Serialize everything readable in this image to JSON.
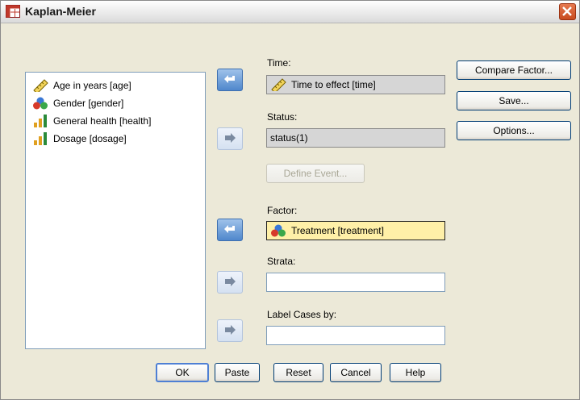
{
  "window": {
    "title": "Kaplan-Meier"
  },
  "variables": [
    {
      "label": "Age in years [age]",
      "icon": "scale-ruler-icon"
    },
    {
      "label": "Gender [gender]",
      "icon": "nominal-circles-icon"
    },
    {
      "label": "General health [health]",
      "icon": "ordinal-bars-icon"
    },
    {
      "label": "Dosage [dosage]",
      "icon": "ordinal-bars-icon"
    }
  ],
  "time": {
    "label": "Time:",
    "value": "Time to effect [time]"
  },
  "status": {
    "label": "Status:",
    "value": "status(1)",
    "define_event": "Define Event..."
  },
  "factor": {
    "label": "Factor:",
    "value": "Treatment [treatment]"
  },
  "strata": {
    "label": "Strata:",
    "value": ""
  },
  "label_cases": {
    "label": "Label Cases by:",
    "value": ""
  },
  "side_buttons": {
    "compare": "Compare Factor...",
    "save": "Save...",
    "options": "Options..."
  },
  "footer": {
    "ok": "OK",
    "paste": "Paste",
    "reset": "Reset",
    "cancel": "Cancel",
    "help": "Help"
  },
  "colors": {
    "title_bar": "#e9e9e9",
    "dialog": "#ece9d8",
    "selection": "#fff0a8",
    "arrow_active": "#4f87cc"
  }
}
